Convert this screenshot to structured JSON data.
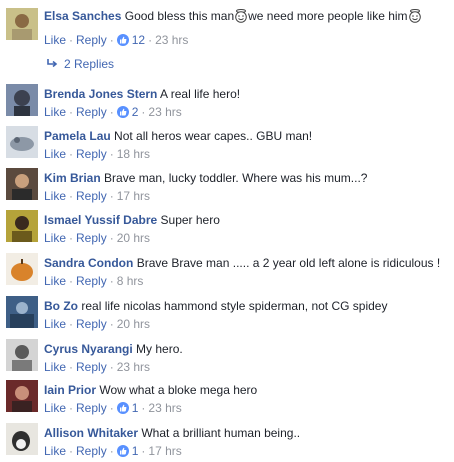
{
  "actions": {
    "like": "Like",
    "reply": "Reply"
  },
  "comments": [
    {
      "author": "Elsa Sanches",
      "text_a": "Good bless this man",
      "text_b": "we need more people like him",
      "likes": "12",
      "time": "23 hrs",
      "replies_label": "2 Replies"
    },
    {
      "author": "Brenda Jones Stern",
      "text": "A real life hero!",
      "likes": "2",
      "time": "23 hrs"
    },
    {
      "author": "Pamela Lau",
      "text": "Not all heros wear capes.. GBU man!",
      "time": "18 hrs"
    },
    {
      "author": "Kim Brian",
      "text": "Brave man, lucky toddler. Where was his mum...?",
      "time": "17 hrs"
    },
    {
      "author": "Ismael Yussif Dabre",
      "text": "Super hero",
      "time": "20 hrs"
    },
    {
      "author": "Sandra Condon",
      "text": "Brave Brave man ..... a 2 year old left alone is ridiculous !",
      "time": "8 hrs"
    },
    {
      "author": "Bo Zo",
      "text": "real life nicolas hammond style spiderman, not CG spidey",
      "time": "20 hrs"
    },
    {
      "author": "Cyrus Nyarangi",
      "text": "My hero.",
      "time": "23 hrs"
    },
    {
      "author": "Iain Prior",
      "text": "Wow what a bloke mega hero",
      "likes": "1",
      "time": "23 hrs"
    },
    {
      "author": "Allison Whitaker",
      "text": "What a brilliant human being..",
      "likes": "1",
      "time": "17 hrs"
    }
  ],
  "colors": {
    "author": "#365899",
    "link": "#4267b2",
    "meta": "#90949c",
    "like_badge": "#5890ff"
  },
  "icons": {
    "emoji": "smiling-face-halo-icon",
    "reply_arrow": "reply-arrow-icon",
    "like": "thumbs-up-icon"
  }
}
